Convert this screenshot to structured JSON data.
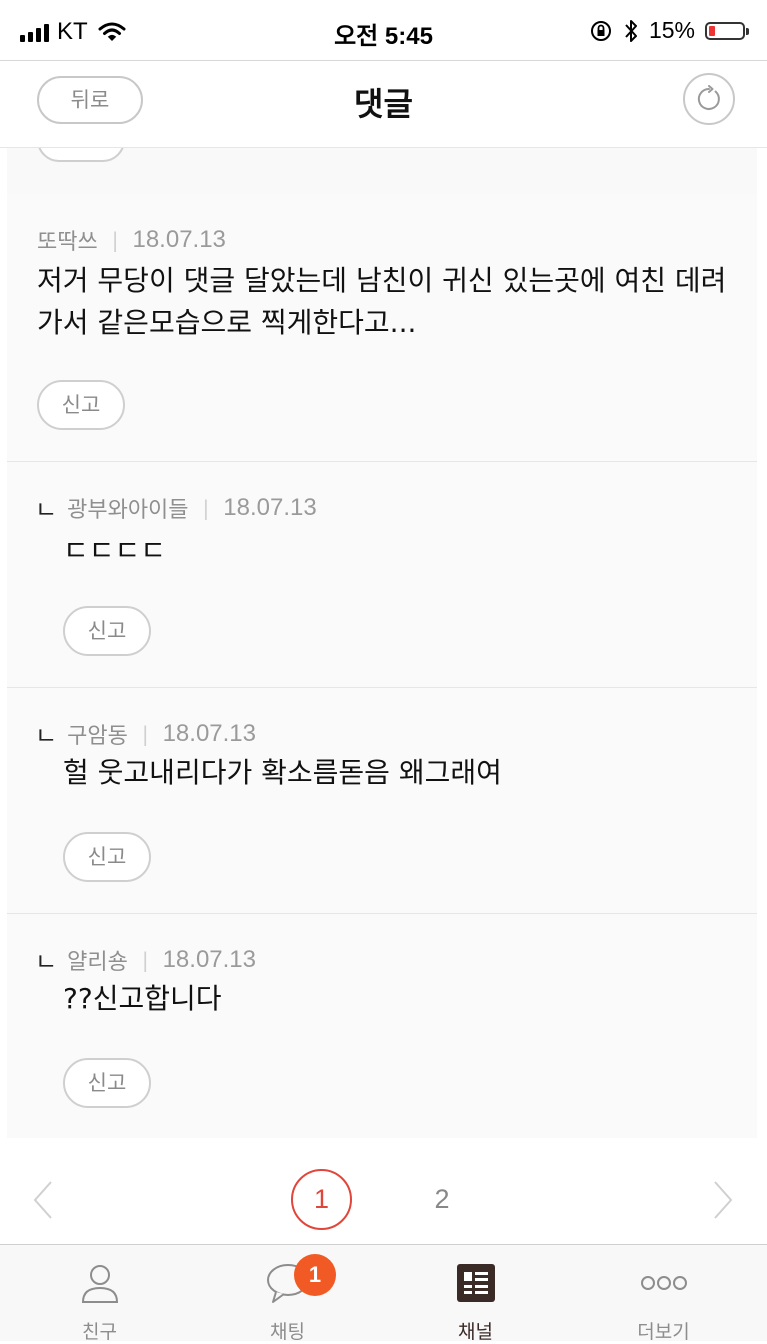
{
  "status_bar": {
    "carrier": "KT",
    "time": "오전 5:45",
    "battery_percent": "15%"
  },
  "header": {
    "back_label": "뒤로",
    "title": "댓글"
  },
  "comments": [
    {
      "author": "또딱쓰",
      "date": "18.07.13",
      "text": "저거 무당이 댓글 달았는데 남친이 귀신 있는곳에 여친 데려가서 같은모습으로 찍게한다고...",
      "is_reply": false,
      "report_label": "신고"
    },
    {
      "reply_mark": "ㄴ",
      "author": "광부와아이들",
      "date": "18.07.13",
      "text": "ㄷㄷㄷㄷ",
      "is_reply": true,
      "report_label": "신고"
    },
    {
      "reply_mark": "ㄴ",
      "author": "구암동",
      "date": "18.07.13",
      "text": "헐 웃고내리다가 확소름돋음 왜그래여",
      "is_reply": true,
      "report_label": "신고"
    },
    {
      "reply_mark": "ㄴ",
      "author": "얄리숑",
      "date": "18.07.13",
      "text": "??신고합니다",
      "is_reply": true,
      "report_label": "신고"
    }
  ],
  "pagination": {
    "pages": [
      "1",
      "2"
    ],
    "current": "1"
  },
  "tab_bar": {
    "tabs": [
      {
        "label": "친구",
        "icon": "person-icon"
      },
      {
        "label": "채팅",
        "icon": "chat-bubble-icon",
        "badge": "1"
      },
      {
        "label": "채널",
        "icon": "channel-icon",
        "active": true
      },
      {
        "label": "더보기",
        "icon": "more-dots-icon"
      }
    ]
  },
  "colors": {
    "accent_red": "#e0463a",
    "badge_orange": "#f15a24",
    "active_tab": "#3b2b27"
  }
}
